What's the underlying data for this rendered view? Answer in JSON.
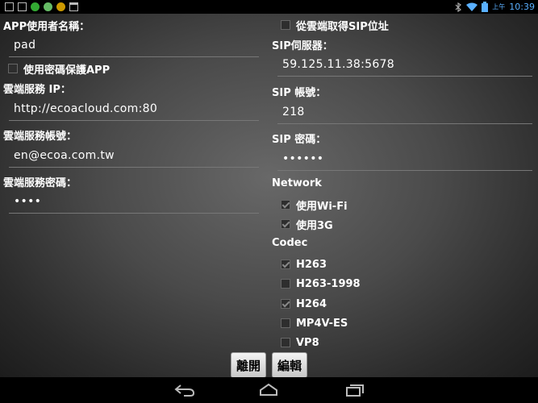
{
  "status_bar": {
    "time": "10:39",
    "ampm": "上午"
  },
  "left": {
    "app_user_label": "APP使用者名稱：",
    "app_user_value": "pad",
    "protect_label": "使用密碼保護APP",
    "cloud_ip_label": "雲端服務 IP：",
    "cloud_ip_value": "http://ecoacloud.com:80",
    "cloud_account_label": "雲端服務帳號：",
    "cloud_account_value": "en@ecoa.com.tw",
    "cloud_password_label": "雲端服務密碼：",
    "cloud_password_value": "••••"
  },
  "right": {
    "get_sip_label": "從雲端取得SIP位址",
    "sip_server_label": "SIP伺服器：",
    "sip_server_value": "59.125.11.38:5678",
    "sip_account_label": "SIP 帳號：",
    "sip_account_value": "218",
    "sip_password_label": "SIP 密碼：",
    "sip_password_value": "••••••",
    "network_label": "Network",
    "network_options": [
      {
        "label": "使用Wi-Fi",
        "checked": true
      },
      {
        "label": "使用3G",
        "checked": true
      }
    ],
    "codec_label": "Codec",
    "codec_options": [
      {
        "label": "H263",
        "checked": true
      },
      {
        "label": "H263-1998",
        "checked": false
      },
      {
        "label": "H264",
        "checked": true
      },
      {
        "label": "MP4V-ES",
        "checked": false
      },
      {
        "label": "VP8",
        "checked": false
      }
    ]
  },
  "buttons": {
    "leave": "離開",
    "edit": "編輯"
  },
  "icons": {
    "back": "back-icon",
    "home": "home-icon",
    "recents": "recents-icon"
  }
}
